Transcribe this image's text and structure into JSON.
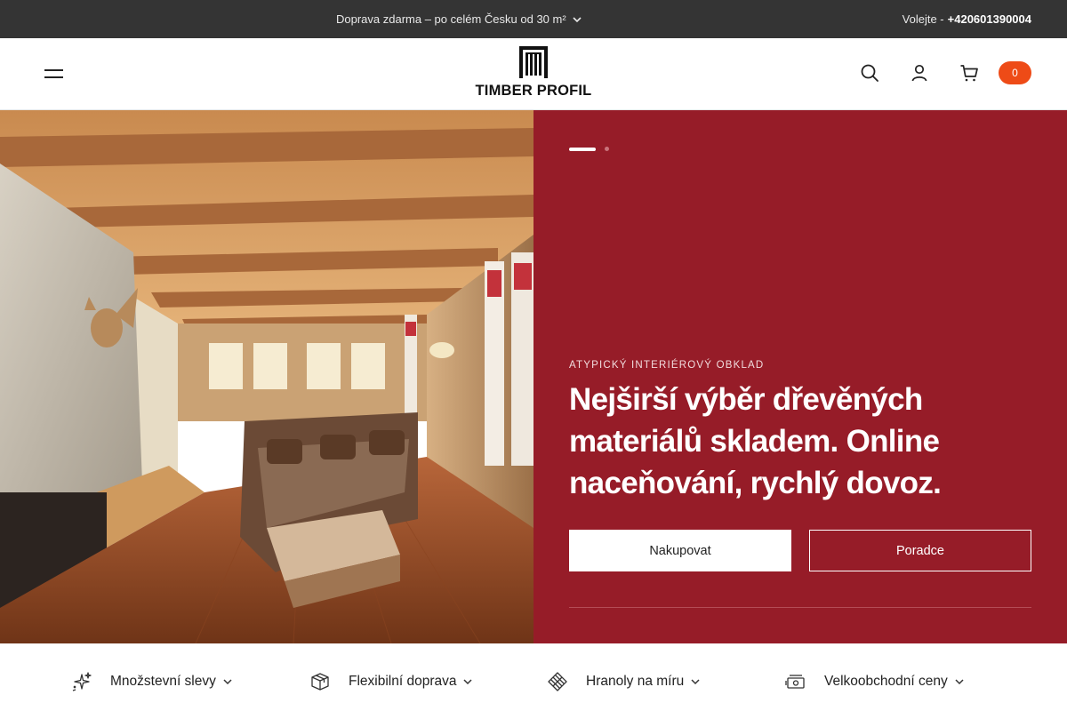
{
  "topbar": {
    "shipping_text": "Doprava zdarma – po celém Česku od 30 m²",
    "phone_label": "Volejte -",
    "phone_number": "+420601390004"
  },
  "header": {
    "logo_text": "TIMBER PROFIL",
    "cart_count": "0",
    "icons": [
      "menu-icon",
      "search-icon",
      "user-icon",
      "cart-icon"
    ]
  },
  "hero": {
    "eyebrow": "ATYPICKÝ INTERIÉROVÝ OBKLAD",
    "headline": "Nejširší výběr dřevěných materiálů skladem. Online naceňování, rychlý dovoz.",
    "primary_button": "Nakupovat",
    "secondary_button": "Poradce",
    "slides": 2,
    "active_slide": 1,
    "accent_color": "#961c28"
  },
  "features": [
    {
      "label": "Množstevní slevy",
      "icon": "sparkles-icon"
    },
    {
      "label": "Flexibilní doprava",
      "icon": "box-icon"
    },
    {
      "label": "Hranoly na míru",
      "icon": "cube-icon"
    },
    {
      "label": "Velkoobchodní ceny",
      "icon": "money-icon"
    }
  ],
  "colors": {
    "topbar_bg": "#343434",
    "badge": "#ee4b17",
    "hero_panel": "#961c28"
  }
}
